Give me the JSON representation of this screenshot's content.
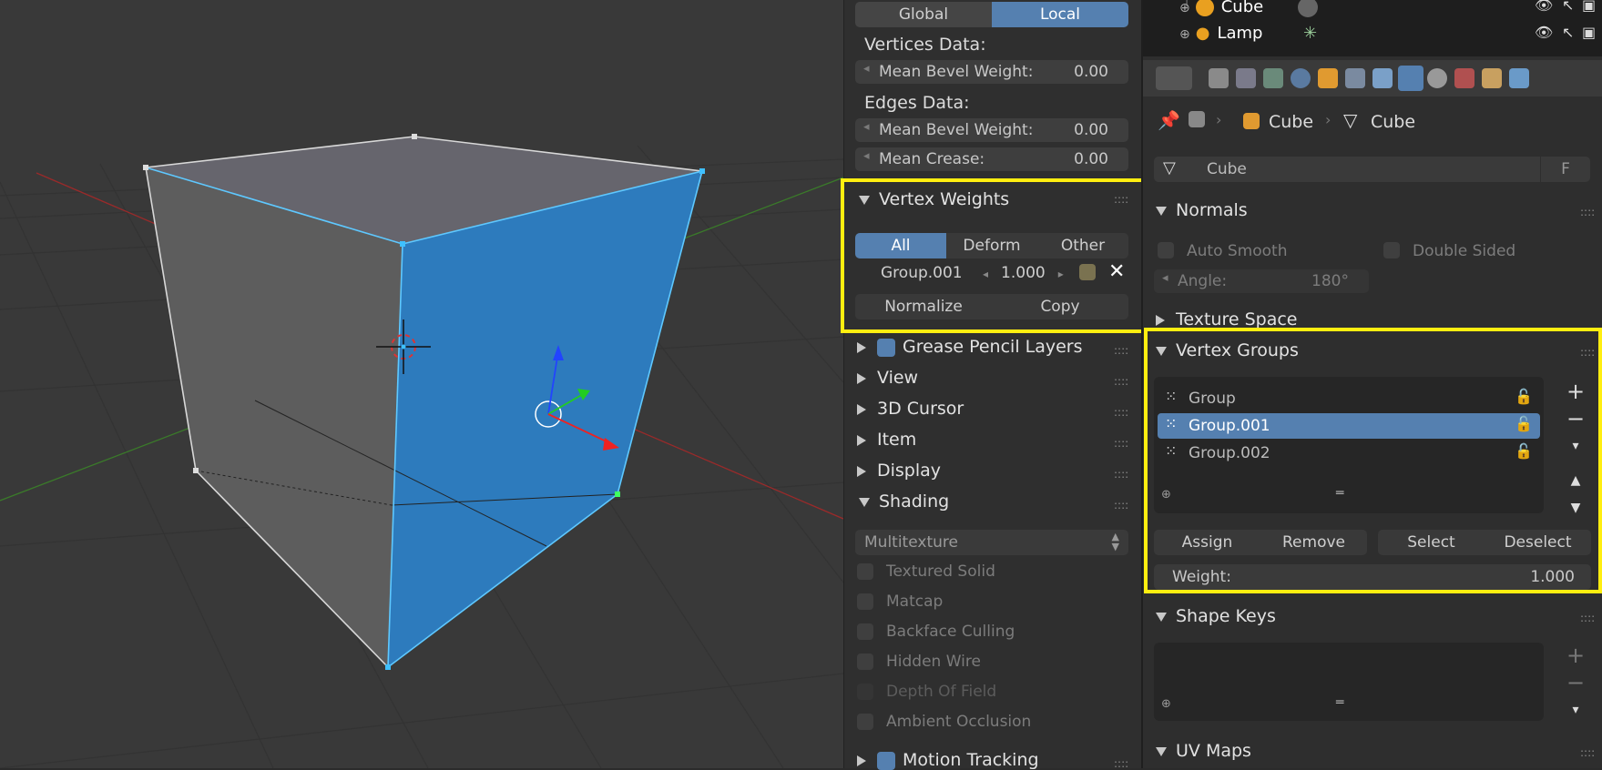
{
  "colors": {
    "accent": "#5580b0",
    "highlight": "#ffee10",
    "face": "#2d7bbd"
  },
  "npanel": {
    "orient_tabs": [
      "Global",
      "Local"
    ],
    "vertices_data_label": "Vertices Data:",
    "vertex_bevel": {
      "label": "Mean Bevel Weight:",
      "value": "0.00"
    },
    "edges_data_label": "Edges Data:",
    "edge_bevel": {
      "label": "Mean Bevel Weight:",
      "value": "0.00"
    },
    "edge_crease": {
      "label": "Mean Crease:",
      "value": "0.00"
    },
    "vertex_weights": {
      "title": "Vertex Weights",
      "tabs": [
        "All",
        "Deform",
        "Other"
      ],
      "group_name": "Group.001",
      "group_weight": "1.000",
      "normalize": "Normalize",
      "copy": "Copy"
    },
    "panels": [
      "Grease Pencil Layers",
      "View",
      "3D Cursor",
      "Item",
      "Display",
      "Shading"
    ],
    "shading": {
      "mode": "Multitexture",
      "options": [
        "Textured Solid",
        "Matcap",
        "Backface Culling",
        "Hidden Wire",
        "Depth Of Field",
        "Ambient Occlusion"
      ]
    },
    "motion_tracking": "Motion Tracking"
  },
  "outliner": {
    "items": [
      "Cube",
      "Lamp"
    ]
  },
  "properties": {
    "breadcrumb": [
      "Cube",
      "Cube"
    ],
    "datablock_name": "Cube",
    "fake_user": "F",
    "normals": {
      "title": "Normals",
      "auto_smooth": "Auto Smooth",
      "double_sided": "Double Sided",
      "angle_label": "Angle:",
      "angle_value": "180°"
    },
    "texture_space": "Texture Space",
    "vertex_groups": {
      "title": "Vertex Groups",
      "items": [
        "Group",
        "Group.001",
        "Group.002"
      ],
      "selected_index": 1,
      "assign": "Assign",
      "remove": "Remove",
      "select": "Select",
      "deselect": "Deselect",
      "weight_label": "Weight:",
      "weight_value": "1.000"
    },
    "shape_keys": "Shape Keys",
    "uv_maps": "UV Maps"
  }
}
